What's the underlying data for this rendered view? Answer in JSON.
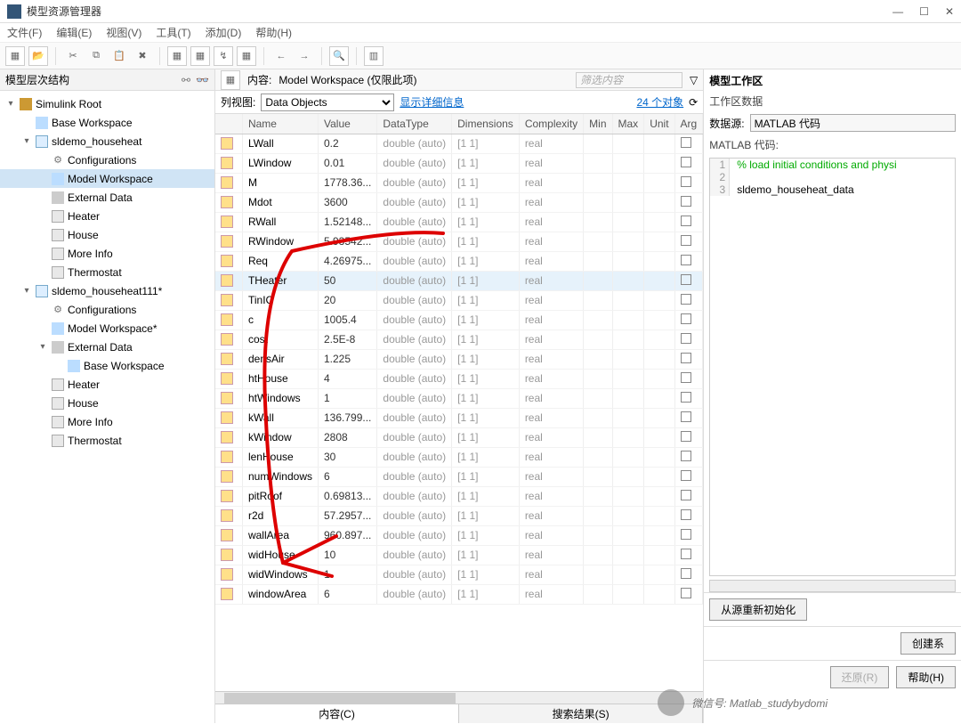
{
  "title": "模型资源管理器",
  "menus": [
    "文件(F)",
    "编辑(E)",
    "视图(V)",
    "工具(T)",
    "添加(D)",
    "帮助(H)"
  ],
  "left_header": "模型层次结构",
  "tree": [
    {
      "d": 0,
      "tw": "▾",
      "ic": "root",
      "label": "Simulink Root"
    },
    {
      "d": 1,
      "tw": "",
      "ic": "ws",
      "label": "Base Workspace"
    },
    {
      "d": 1,
      "tw": "▾",
      "ic": "model",
      "label": "sldemo_househeat"
    },
    {
      "d": 2,
      "tw": "",
      "ic": "gear",
      "label": "Configurations"
    },
    {
      "d": 2,
      "tw": "",
      "ic": "ws",
      "label": "Model Workspace",
      "sel": true
    },
    {
      "d": 2,
      "tw": "",
      "ic": "ext",
      "label": "External Data"
    },
    {
      "d": 2,
      "tw": "",
      "ic": "node",
      "label": "Heater"
    },
    {
      "d": 2,
      "tw": "",
      "ic": "node",
      "label": "House"
    },
    {
      "d": 2,
      "tw": "",
      "ic": "node",
      "label": "More Info"
    },
    {
      "d": 2,
      "tw": "",
      "ic": "node",
      "label": "Thermostat"
    },
    {
      "d": 1,
      "tw": "▾",
      "ic": "model",
      "label": "sldemo_househeat111*"
    },
    {
      "d": 2,
      "tw": "",
      "ic": "gear",
      "label": "Configurations"
    },
    {
      "d": 2,
      "tw": "",
      "ic": "ws",
      "label": "Model Workspace*"
    },
    {
      "d": 2,
      "tw": "▾",
      "ic": "ext",
      "label": "External Data"
    },
    {
      "d": 3,
      "tw": "",
      "ic": "ws",
      "label": "Base Workspace"
    },
    {
      "d": 2,
      "tw": "",
      "ic": "node",
      "label": "Heater"
    },
    {
      "d": 2,
      "tw": "",
      "ic": "node",
      "label": "House"
    },
    {
      "d": 2,
      "tw": "",
      "ic": "node",
      "label": "More Info"
    },
    {
      "d": 2,
      "tw": "",
      "ic": "node",
      "label": "Thermostat"
    }
  ],
  "mid": {
    "label_content": "内容:",
    "scope": "Model Workspace (仅限此项)",
    "filter_placeholder": "筛选内容",
    "listview_label": "列视图:",
    "listview_value": "Data Objects",
    "details_link": "显示详细信息",
    "count_link": "24 个对象",
    "columns": [
      "Name",
      "Value",
      "DataType",
      "Dimensions",
      "Complexity",
      "Min",
      "Max",
      "Unit",
      "Arg"
    ],
    "rows": [
      {
        "n": "LWall",
        "v": "0.2"
      },
      {
        "n": "LWindow",
        "v": "0.01"
      },
      {
        "n": "M",
        "v": "1778.36..."
      },
      {
        "n": "Mdot",
        "v": "3600"
      },
      {
        "n": "RWall",
        "v": "1.52148..."
      },
      {
        "n": "RWindow",
        "v": "5.93542..."
      },
      {
        "n": "Req",
        "v": "4.26975..."
      },
      {
        "n": "THeater",
        "v": "50",
        "sel": true
      },
      {
        "n": "TinIC",
        "v": "20"
      },
      {
        "n": "c",
        "v": "1005.4"
      },
      {
        "n": "cost",
        "v": "2.5E-8"
      },
      {
        "n": "densAir",
        "v": "1.225"
      },
      {
        "n": "htHouse",
        "v": "4"
      },
      {
        "n": "htWindows",
        "v": "1"
      },
      {
        "n": "kWall",
        "v": "136.799..."
      },
      {
        "n": "kWindow",
        "v": "2808"
      },
      {
        "n": "lenHouse",
        "v": "30"
      },
      {
        "n": "numWindows",
        "v": "6"
      },
      {
        "n": "pitRoof",
        "v": "0.69813..."
      },
      {
        "n": "r2d",
        "v": "57.2957..."
      },
      {
        "n": "wallArea",
        "v": "960.897..."
      },
      {
        "n": "widHouse",
        "v": "10"
      },
      {
        "n": "widWindows",
        "v": "1"
      },
      {
        "n": "windowArea",
        "v": "6"
      }
    ],
    "datatype": "double (auto)",
    "dims": "[1 1]",
    "complexity": "real",
    "tab_content": "内容(C)",
    "tab_search": "搜索结果(S)"
  },
  "right": {
    "title": "模型工作区",
    "subtitle": "工作区数据",
    "src_label": "数据源:",
    "src_value": "MATLAB 代码",
    "code_label": "MATLAB 代码:",
    "code": [
      {
        "n": "1",
        "t": "% load initial conditions and physi",
        "c": true
      },
      {
        "n": "2",
        "t": "",
        "c": false
      },
      {
        "n": "3",
        "t": "sldemo_househeat_data",
        "c": false
      }
    ],
    "btn_reinit": "从源重新初始化",
    "btn_create": "创建系",
    "btn_restore": "还原(R)",
    "btn_help": "帮助(H)"
  },
  "watermark": "微信号: Matlab_studybydomi"
}
